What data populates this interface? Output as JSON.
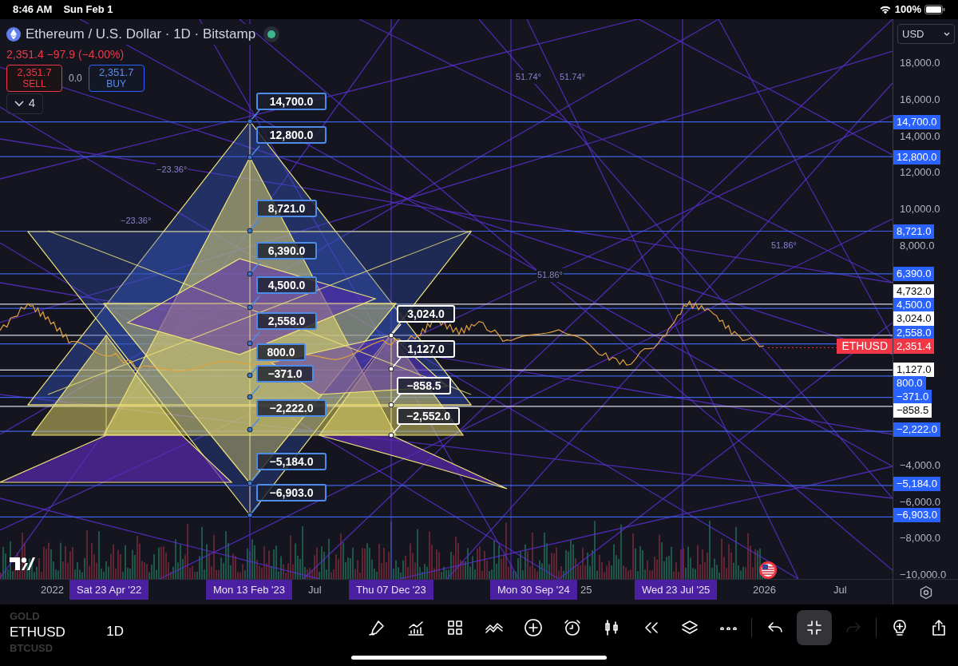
{
  "status_bar": {
    "time": "8:46 AM",
    "date": "Sun Feb 1",
    "battery": "100%"
  },
  "symbol": {
    "title": "Ethereum / U.S. Dollar · 1D · Bitstamp",
    "quote": "2,351.4 −97.9 (−4.00%)",
    "sell": {
      "price": "2,351.7",
      "label": "SELL"
    },
    "spread": "0.0",
    "buy": {
      "price": "2,351.7",
      "label": "BUY"
    },
    "indicators": {
      "count": "4",
      "expanded": false
    }
  },
  "currency": "USD",
  "price_axis": {
    "ticks": [
      "18,000.0",
      "16,000.0",
      "14,000.0",
      "12,000.0",
      "10,000.0",
      "8,000.0",
      "−4,000.0",
      "−6,000.0",
      "−8,000.0",
      "−10,000.0"
    ],
    "levels": [
      {
        "label": "14,700.0",
        "kind": "fan"
      },
      {
        "label": "12,800.0",
        "kind": "fan"
      },
      {
        "label": "8,721.0",
        "kind": "fan"
      },
      {
        "label": "6,390.0",
        "kind": "fan"
      },
      {
        "label": "4,732.0",
        "kind": "pivot"
      },
      {
        "label": "4,500.0",
        "kind": "fan"
      },
      {
        "label": "3,024.0",
        "kind": "pivot"
      },
      {
        "label": "2,558.0",
        "kind": "fan"
      },
      {
        "label": "1,127.0",
        "kind": "pivot"
      },
      {
        "label": "800.0",
        "kind": "fan"
      },
      {
        "label": "−371.0",
        "kind": "fan"
      },
      {
        "label": "−858.5",
        "kind": "pivot"
      },
      {
        "label": "−2,222.0",
        "kind": "fan"
      },
      {
        "label": "−5,184.0",
        "kind": "fan"
      },
      {
        "label": "−6,903.0",
        "kind": "fan"
      }
    ]
  },
  "last_price": {
    "symbol": "ETHUSD",
    "price": "2,351.4"
  },
  "callouts": [
    {
      "label": "14,700.0",
      "kind": "fan"
    },
    {
      "label": "12,800.0",
      "kind": "fan"
    },
    {
      "label": "8,721.0",
      "kind": "fan"
    },
    {
      "label": "6,390.0",
      "kind": "fan"
    },
    {
      "label": "4,500.0",
      "kind": "fan"
    },
    {
      "label": "2,558.0",
      "kind": "fan"
    },
    {
      "label": "800.0",
      "kind": "fan"
    },
    {
      "label": "−371.0",
      "kind": "fan"
    },
    {
      "label": "−2,222.0",
      "kind": "fan"
    },
    {
      "label": "−5,184.0",
      "kind": "fan"
    },
    {
      "label": "−6,903.0",
      "kind": "fan"
    },
    {
      "label": "3,024.0",
      "kind": "pivot"
    },
    {
      "label": "1,127.0",
      "kind": "pivot"
    },
    {
      "label": "−858.5",
      "kind": "pivot"
    },
    {
      "label": "−2,552.0",
      "kind": "pivot"
    }
  ],
  "angle_labels": [
    "51.74°",
    "51.74°",
    "−23.36°",
    "−23.36°",
    "51.86°",
    "51.86°"
  ],
  "time_axis": [
    {
      "text": "2022",
      "highlighted": false
    },
    {
      "text": "Sat 23 Apr '22",
      "highlighted": true
    },
    {
      "text": "Mon 13 Feb '23",
      "highlighted": true
    },
    {
      "text": "Jul",
      "highlighted": false
    },
    {
      "text": "Thu 07 Dec '23",
      "highlighted": true
    },
    {
      "text": "Mon 30 Sep '24",
      "highlighted": true
    },
    {
      "text": "25",
      "highlighted": false
    },
    {
      "text": "Wed 23 Jul '25",
      "highlighted": true
    },
    {
      "text": "2026",
      "highlighted": false
    },
    {
      "text": "Jul",
      "highlighted": false
    }
  ],
  "toolbar": {
    "symbols": [
      {
        "text": "GOLD",
        "selected": false
      },
      {
        "text": "ETHUSD",
        "selected": true
      },
      {
        "text": "BTCUSD",
        "selected": false
      }
    ],
    "interval": "1D",
    "tools": [
      {
        "kind": "pen",
        "selected": false,
        "disabled": false
      },
      {
        "kind": "indicators",
        "selected": false,
        "disabled": false
      },
      {
        "kind": "grid",
        "selected": false,
        "disabled": false
      },
      {
        "kind": "patterns",
        "selected": false,
        "disabled": false
      },
      {
        "kind": "add",
        "selected": false,
        "disabled": false
      },
      {
        "kind": "alarm",
        "selected": false,
        "disabled": false
      },
      {
        "kind": "candles",
        "selected": false,
        "disabled": false
      },
      {
        "kind": "rewind",
        "selected": false,
        "disabled": false
      },
      {
        "kind": "layers",
        "selected": false,
        "disabled": false
      },
      {
        "kind": "more",
        "selected": false,
        "disabled": false
      },
      {
        "kind": "undo",
        "selected": false,
        "disabled": false
      },
      {
        "kind": "collapse",
        "selected": true,
        "disabled": false
      },
      {
        "kind": "redo",
        "selected": false,
        "disabled": true
      },
      {
        "kind": "idea",
        "selected": false,
        "disabled": false
      },
      {
        "kind": "share",
        "selected": false,
        "disabled": false
      }
    ]
  }
}
